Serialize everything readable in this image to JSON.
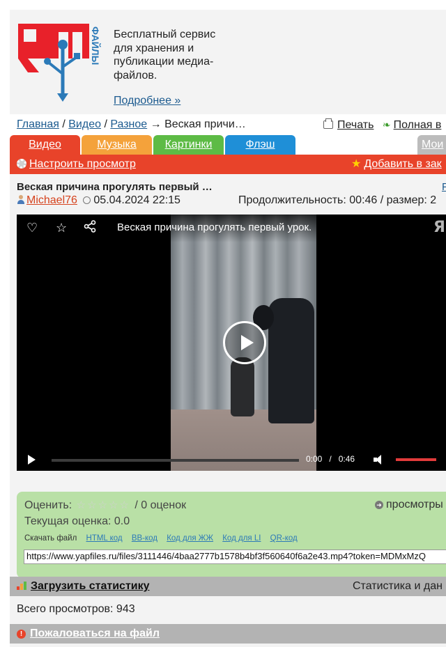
{
  "header": {
    "tagline_lines": [
      "Бесплатный сервис",
      "для хранения и",
      "публикации медиа-",
      "файлов."
    ],
    "more_link": "Подробнее »"
  },
  "breadcrumb": {
    "home": "Главная",
    "video": "Видео",
    "misc": "Разное",
    "current": "→ Веская причи…",
    "print": "Печать",
    "full_version": "Полная в"
  },
  "tabs": [
    "Видео",
    "Музыка",
    "Картинки",
    "Флэш",
    "Мои"
  ],
  "toolbar": {
    "configure": "Настроить просмотр",
    "add_bookmark": "Добавить в зак"
  },
  "file": {
    "title": "Веская причина прогулять первый …",
    "right_letter": "F",
    "author": "Michael76",
    "date": "05.04.2024 22:15",
    "duration_label": "Продолжительность: 00:46 / размер: 2"
  },
  "player": {
    "title": "Веская причина прогулять первый урок.",
    "watermark": "Я",
    "current_time": "0:00",
    "total_time": "0:46",
    "progress": 0,
    "volume": 1.0
  },
  "rating": {
    "label": "Оценить:",
    "stars": "☆☆☆☆☆",
    "count": "/ 0 оценок",
    "views_label": "просмотры",
    "current": "Текущая оценка: 0.0",
    "download_label": "Скачать файл",
    "codes": [
      "HTML код",
      "BB-код",
      "Код для ЖЖ",
      "Код для LI",
      "QR-код"
    ],
    "url": "https://www.yapfiles.ru/files/3111446/4baa2777b1578b4bf3f560640f6a2e43.mp4?token=MDMxMzQ"
  },
  "stats": {
    "load_link": "Загрузить статистику",
    "right": "Статистика и дан",
    "total_views": "Всего просмотров: 943",
    "report": "Пожаловаться на файл"
  },
  "colors": {
    "accent_red": "#e8432a",
    "tab_music": "#f4a23b",
    "tab_pics": "#5dbb45",
    "tab_flash": "#1f8fd7",
    "rating_bg": "#b9e0a6"
  }
}
